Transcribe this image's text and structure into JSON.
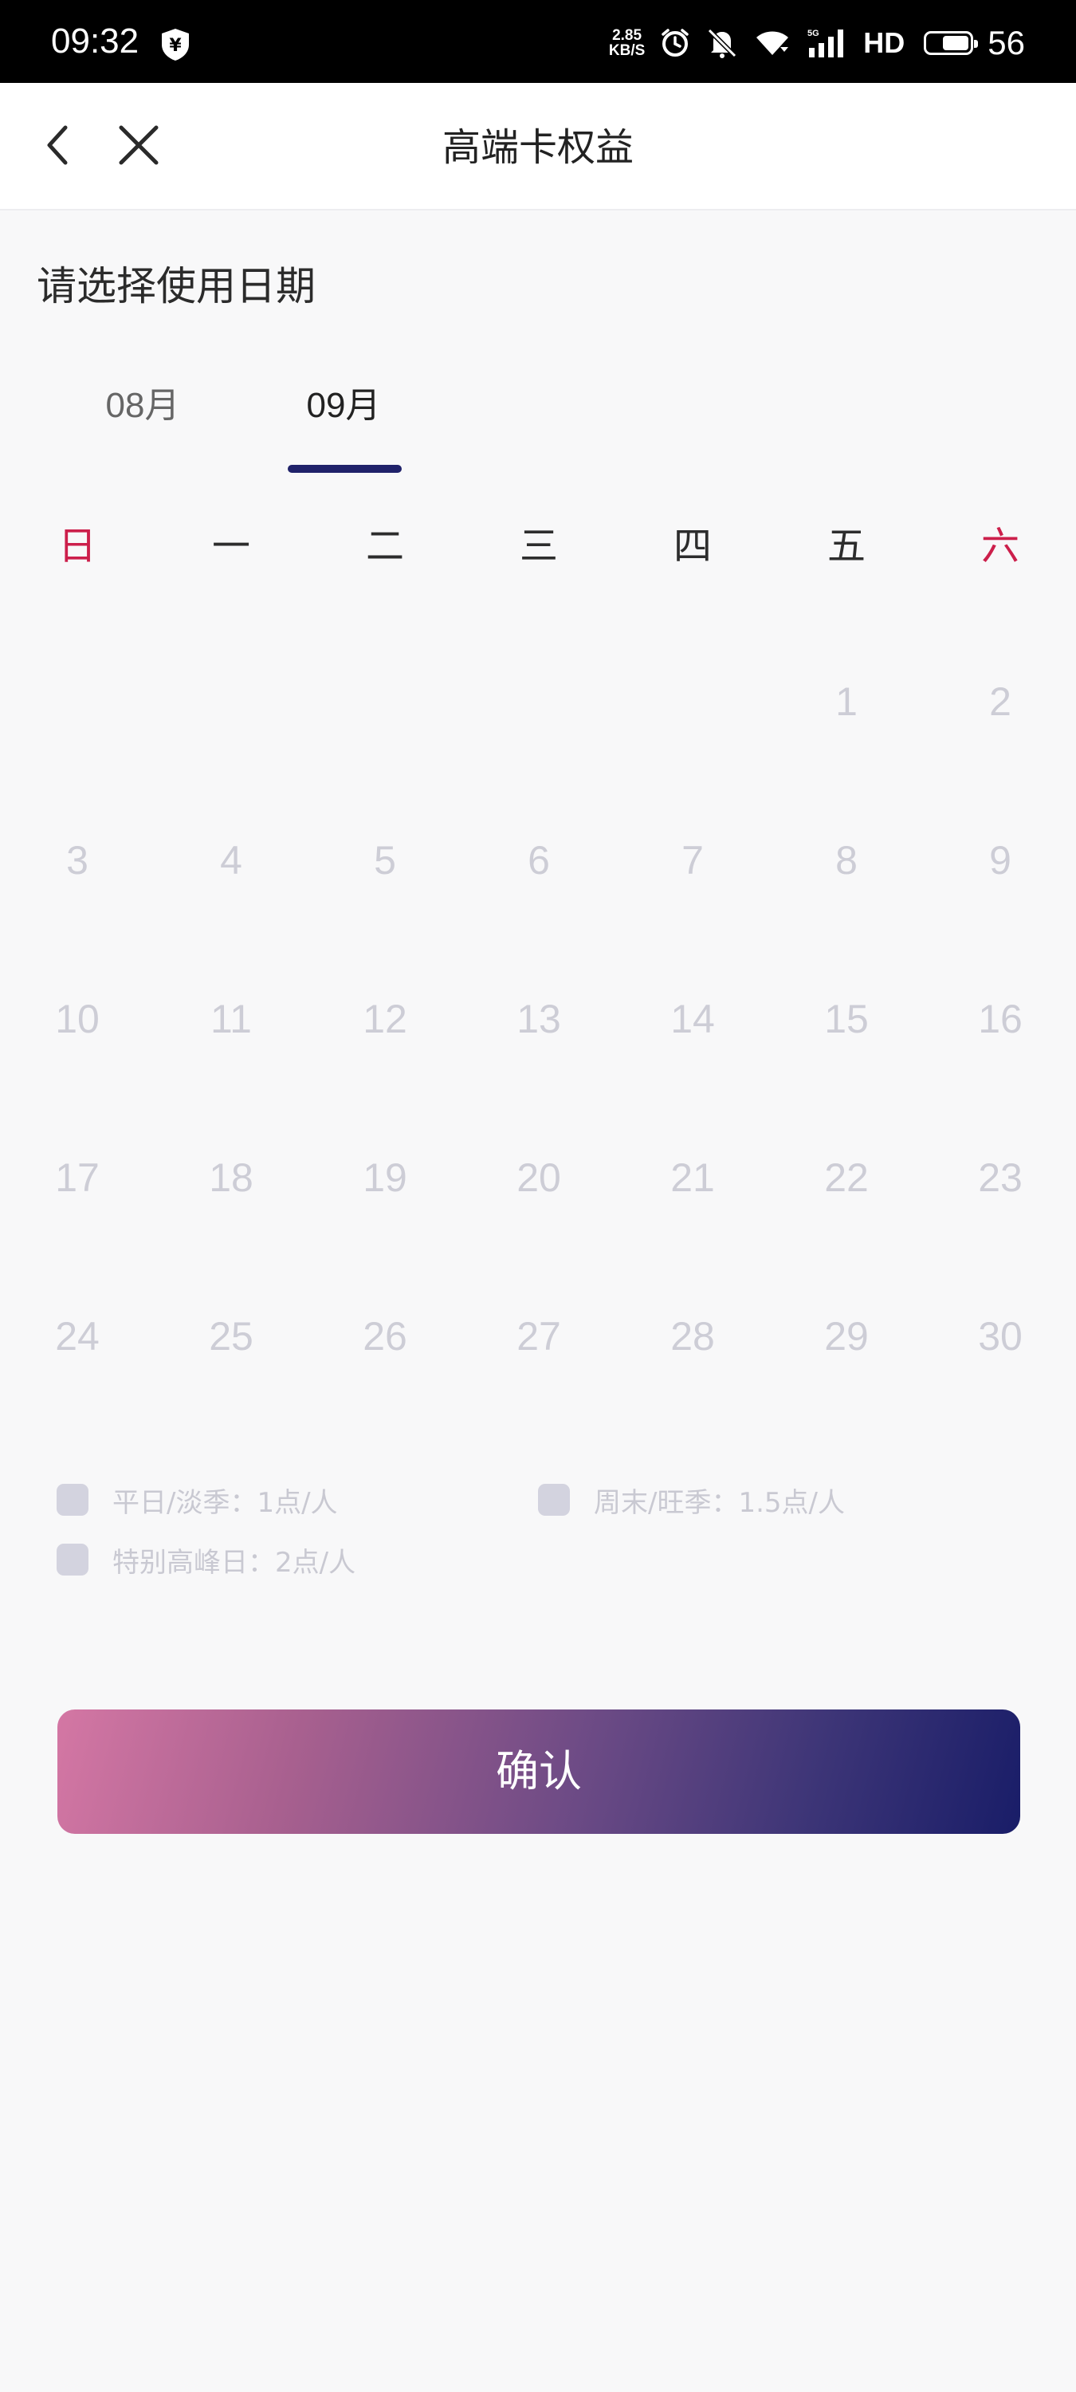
{
  "status_bar": {
    "time": "09:32",
    "net_speed_value": "2.85",
    "net_speed_unit": "KB/S",
    "network_label": "HD",
    "signal_badge": "5G",
    "battery_level": "56",
    "icons": [
      "shield-yuan-icon",
      "alarm-icon",
      "mute-icon",
      "wifi-icon",
      "signal-icon",
      "battery-icon"
    ]
  },
  "header": {
    "title": "高端卡权益",
    "back_icon": "chevron-left-icon",
    "close_icon": "close-icon"
  },
  "section": {
    "title": "请选择使用日期"
  },
  "month_tabs": {
    "items": [
      {
        "label": "08月",
        "active": false
      },
      {
        "label": "09月",
        "active": true
      }
    ]
  },
  "calendar": {
    "weekdays": [
      "日",
      "一",
      "二",
      "三",
      "四",
      "五",
      "六"
    ],
    "weekend_color": "#cc1f4b",
    "day_color_disabled": "#cdcdd6",
    "month": "09月",
    "first_weekday_index": 5,
    "days": [
      "1",
      "2",
      "3",
      "4",
      "5",
      "6",
      "7",
      "8",
      "9",
      "10",
      "11",
      "12",
      "13",
      "14",
      "15",
      "16",
      "17",
      "18",
      "19",
      "20",
      "21",
      "22",
      "23",
      "24",
      "25",
      "26",
      "27",
      "28",
      "29",
      "30"
    ]
  },
  "legend": {
    "weekday": "平日/淡季：1点/人",
    "weekend": "周末/旺季：1.5点/人",
    "peak": "特别高峰日：2点/人"
  },
  "confirm": {
    "label": "确认",
    "gradient_start": "#d477a4",
    "gradient_end": "#191d68"
  }
}
